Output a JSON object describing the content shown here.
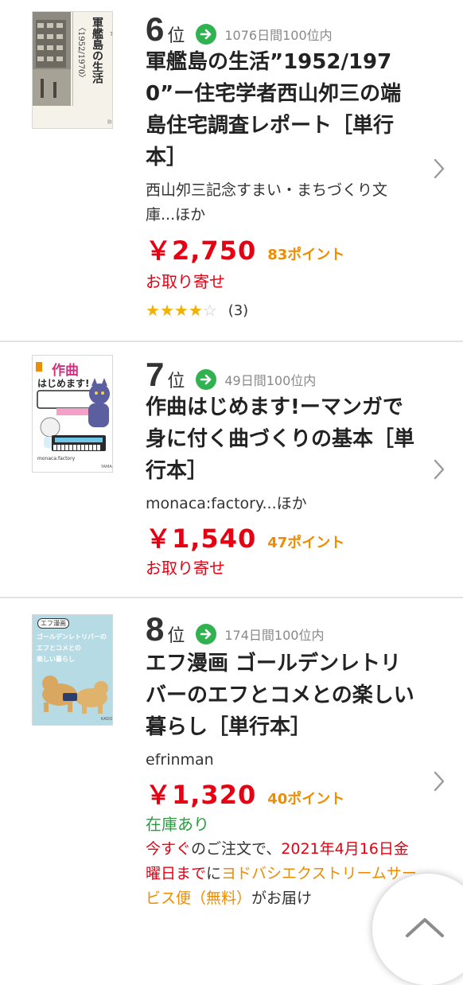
{
  "items": [
    {
      "rank": "6",
      "rank_unit": "位",
      "rank_days": "1076日間100位内",
      "title": "軍艦島の生活”1952/1970”ー住宅学者西山夘三の端島住宅調査レポート［単行本］",
      "author": "西山夘三記念すまい・まちづくり文庫...ほか",
      "price": "￥2,750",
      "points": "83ポイント",
      "stock": "お取り寄せ",
      "rating": 4,
      "rating_max": 5,
      "review_count": "(3)",
      "cover": {
        "title_v1": "軍艦島の生活",
        "title_v2": "〈1952/1970〉"
      }
    },
    {
      "rank": "7",
      "rank_unit": "位",
      "rank_days": "49日間100位内",
      "title": "作曲はじめます!ーマンガで身に付く曲づくりの基本［単行本］",
      "author": "monaca:factory...ほか",
      "price": "￥1,540",
      "points": "47ポイント",
      "stock": "お取り寄せ",
      "cover": {
        "title_a": "作曲",
        "title_b": "はじめます!",
        "credit": "monaca:factory"
      }
    },
    {
      "rank": "8",
      "rank_unit": "位",
      "rank_days": "174日間100位内",
      "title": "エフ漫画 ゴールデンレトリバーのエフとコメとの楽しい暮らし［単行本］",
      "author": "efrinman",
      "price": "￥1,320",
      "points": "40ポイント",
      "stock": "在庫あり",
      "delivery": {
        "now": "今すぐ",
        "p1": "のご注文で、",
        "date": "2021年4月16日金曜日まで",
        "p2": "に",
        "service": "ヨドバシエクストリームサービス便（無料）",
        "p3": "がお届け"
      },
      "cover": {
        "badge": "エフ漫画",
        "line1": "ゴールデンレトリバーの",
        "line2": "エフとコメとの",
        "line3": "楽しい暮らし"
      }
    }
  ],
  "colors": {
    "price": "#e60012",
    "points": "#f08c00",
    "in_stock": "#2a9d3f",
    "rank_arrow": "#2fb24f",
    "star": "#f2b000"
  },
  "icons": {
    "rank_trend": "arrow-right-icon",
    "row_link": "chevron-right-icon",
    "scroll_top": "chevron-up-icon"
  }
}
